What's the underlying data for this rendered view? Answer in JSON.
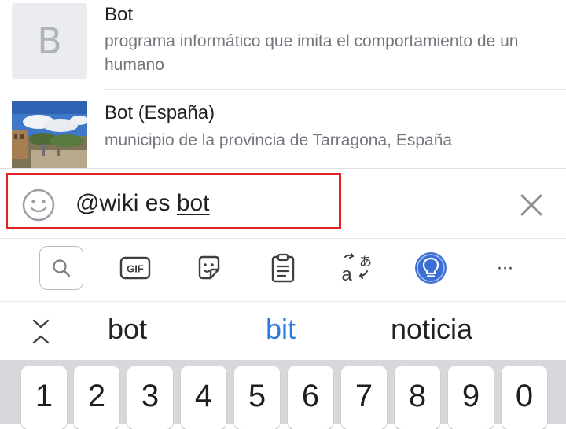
{
  "results": [
    {
      "title": "Bot",
      "description": "programa informático que imita el comportamiento de un humano",
      "thumbnail_letter": "B"
    },
    {
      "title": "Bot (España)",
      "description": "municipio de la provincia de Tarragona, España",
      "thumbnail": "town-photo"
    }
  ],
  "input": {
    "prefix": "@wiki es ",
    "current_word": "bot",
    "left_icon": "smiley-icon",
    "right_icon": "close-icon"
  },
  "toolbar": {
    "icons": [
      "search-icon",
      "gif-icon",
      "sticker-icon",
      "clipboard-icon",
      "translate-icon",
      "lightbulb-icon",
      "more-icon"
    ],
    "gif_label": "GIF",
    "more_label": "···",
    "translate_a": "a",
    "translate_b": "あ"
  },
  "suggestions": {
    "collapse_icon": "collapse-icon",
    "items": [
      "bot",
      "bit",
      "noticia"
    ],
    "highlighted": "bit"
  },
  "keyboard": {
    "number_row": [
      "1",
      "2",
      "3",
      "4",
      "5",
      "6",
      "7",
      "8",
      "9",
      "0"
    ]
  },
  "colors": {
    "highlight_box": "#e02424",
    "accent_blue": "#2c7be5",
    "text_primary": "#202122",
    "text_secondary": "#72777d"
  }
}
